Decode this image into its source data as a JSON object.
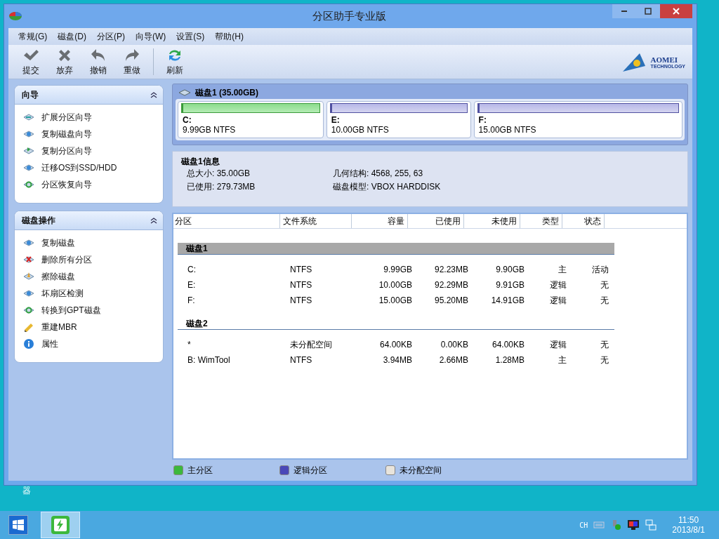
{
  "window": {
    "title": "分区助手专业版"
  },
  "menu": [
    {
      "label": "常规(G)"
    },
    {
      "label": "磁盘(D)"
    },
    {
      "label": "分区(P)"
    },
    {
      "label": "向导(W)"
    },
    {
      "label": "设置(S)"
    },
    {
      "label": "帮助(H)"
    }
  ],
  "toolbar": [
    {
      "label": "提交",
      "kind": "check"
    },
    {
      "label": "放弃",
      "kind": "cross"
    },
    {
      "label": "撤销",
      "kind": "undo"
    },
    {
      "label": "重做",
      "kind": "redo"
    },
    {
      "label": "刷新",
      "kind": "refresh"
    }
  ],
  "logo": {
    "name": "AOMEI",
    "tagline": "TECHNOLOGY"
  },
  "sidebar": [
    {
      "title": "向导",
      "expanded": true,
      "items": [
        {
          "label": "扩展分区向导",
          "kind": "extend"
        },
        {
          "label": "复制磁盘向导",
          "kind": "copy"
        },
        {
          "label": "复制分区向导",
          "kind": "copypart"
        },
        {
          "label": "迁移OS到SSD/HDD",
          "kind": "copy"
        },
        {
          "label": "分区恢复向导",
          "kind": "recover"
        }
      ]
    },
    {
      "title": "磁盘操作",
      "expanded": true,
      "items": [
        {
          "label": "复制磁盘",
          "kind": "copy"
        },
        {
          "label": "删除所有分区",
          "kind": "delete"
        },
        {
          "label": "擦除磁盘",
          "kind": "wipe"
        },
        {
          "label": "坏扇区检测",
          "kind": "scan"
        },
        {
          "label": "转换到GPT磁盘",
          "kind": "recover"
        },
        {
          "label": "重建MBR",
          "kind": "mbr"
        },
        {
          "label": "属性",
          "kind": "info"
        }
      ]
    }
  ],
  "disk_map": {
    "title": "磁盘1 (35.00GB)",
    "selected": true,
    "partitions": [
      {
        "letter": "C:",
        "info": "9.99GB NTFS",
        "kind": "primary"
      },
      {
        "letter": "E:",
        "info": "10.00GB NTFS",
        "kind": "logical"
      },
      {
        "letter": "F:",
        "info": "15.00GB NTFS",
        "kind": "logical"
      }
    ]
  },
  "disk_info": {
    "title": "磁盘1信息",
    "fields": [
      {
        "label": "总大小:",
        "value": "35.00GB"
      },
      {
        "label": "几何结构:",
        "value": "4568, 255, 63"
      },
      {
        "label": "已使用:",
        "value": "279.73MB"
      },
      {
        "label": "磁盘模型:",
        "value": "VBOX HARDDISK"
      }
    ]
  },
  "table": {
    "columns": [
      "分区",
      "文件系统",
      "容量",
      "已使用",
      "未使用",
      "类型",
      "状态"
    ],
    "groups": [
      {
        "name": "磁盘1",
        "selected": true,
        "rows": [
          [
            "C:",
            "NTFS",
            "9.99GB",
            "92.23MB",
            "9.90GB",
            "主",
            "活动"
          ],
          [
            "E:",
            "NTFS",
            "10.00GB",
            "92.29MB",
            "9.91GB",
            "逻辑",
            "无"
          ],
          [
            "F:",
            "NTFS",
            "15.00GB",
            "95.20MB",
            "14.91GB",
            "逻辑",
            "无"
          ]
        ]
      },
      {
        "name": "磁盘2",
        "selected": false,
        "rows": [
          [
            "*",
            "未分配空间",
            "64.00KB",
            "0.00KB",
            "64.00KB",
            "逻辑",
            "无"
          ],
          [
            "B: WimTool",
            "NTFS",
            "3.94MB",
            "2.66MB",
            "1.28MB",
            "主",
            "无"
          ]
        ]
      }
    ]
  },
  "legend": [
    {
      "label": "主分区",
      "color": "#3cb83c"
    },
    {
      "label": "逻辑分区",
      "color": "#4a48b8"
    },
    {
      "label": "未分配空间",
      "color": "#e8e4dc"
    }
  ],
  "desktop_icon": {
    "label": "器"
  },
  "taskbar": {
    "language": "CH",
    "time": "11:50",
    "date": "2013/8/1"
  }
}
